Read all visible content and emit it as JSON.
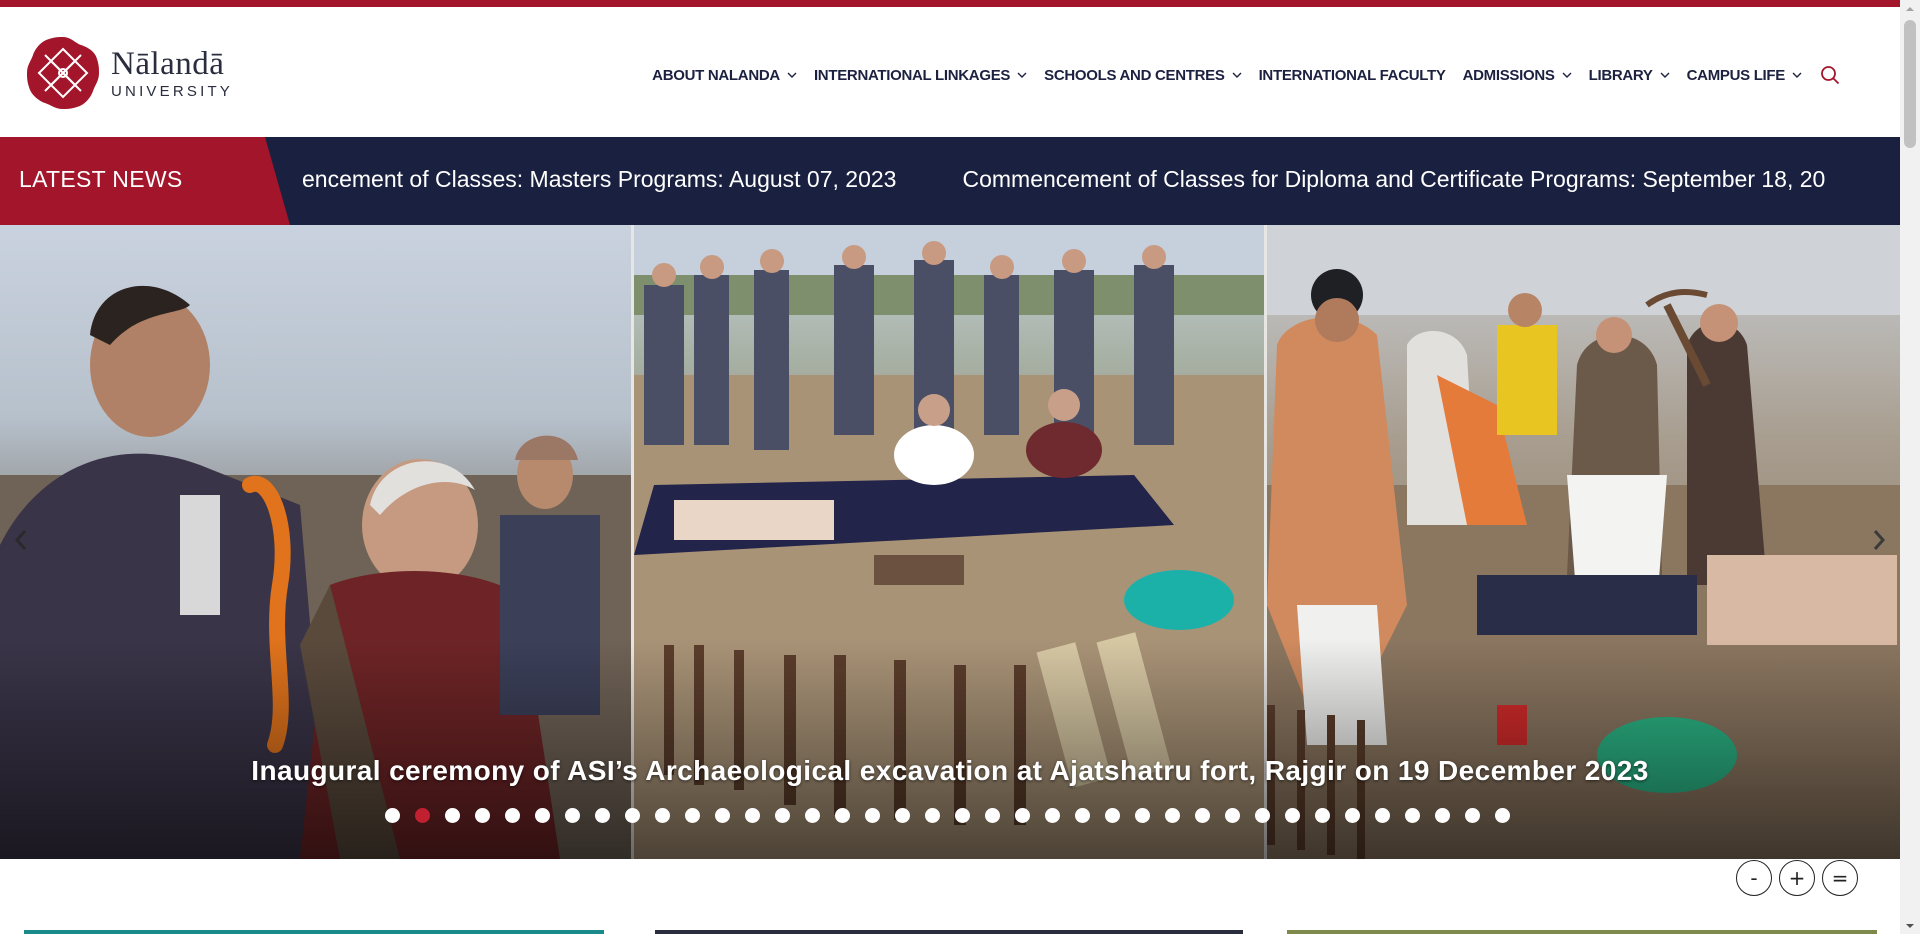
{
  "brand": {
    "name": "Nālandā",
    "sub": "UNIVERSITY",
    "accent": "#a3152a",
    "navy": "#1a2140"
  },
  "nav": {
    "items": [
      {
        "label": "ABOUT NALANDA",
        "dropdown": true
      },
      {
        "label": "INTERNATIONAL LINKAGES",
        "dropdown": true
      },
      {
        "label": "SCHOOLS AND CENTRES",
        "dropdown": true
      },
      {
        "label": "INTERNATIONAL FACULTY",
        "dropdown": false
      },
      {
        "label": "ADMISSIONS",
        "dropdown": true
      },
      {
        "label": "LIBRARY",
        "dropdown": true
      },
      {
        "label": "CAMPUS LIFE",
        "dropdown": true
      }
    ],
    "search_icon": "search-icon"
  },
  "ticker": {
    "label": "LATEST NEWS",
    "items": [
      "encement of Classes: Masters Programs: August 07, 2023",
      "Commencement of Classes for Diploma and Certificate Programs: September 18, 20"
    ]
  },
  "slider": {
    "caption": "Inaugural ceremony of ASI’s Archaeological excavation at Ajatshatru fort, Rajgir on 19 December 2023",
    "dot_count": 38,
    "active_dot": 2
  },
  "font_controls": {
    "decrease": "-",
    "increase": "+",
    "reset": "="
  }
}
